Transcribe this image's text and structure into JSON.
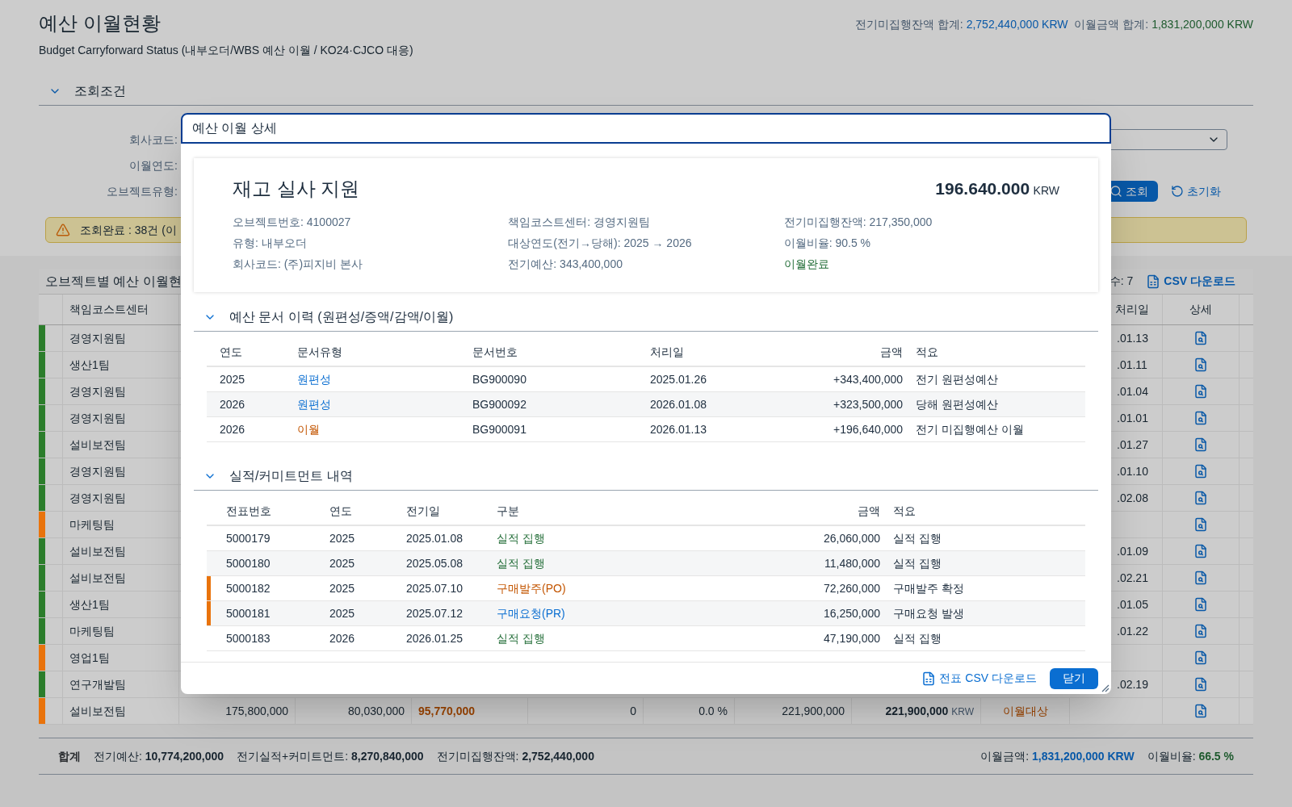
{
  "header": {
    "title": "예산 이월현황",
    "subtitle": "Budget Carryforward Status (내부오더/WBS 예산 이월 / KO24·CJCO 대응)",
    "totals": [
      {
        "label": "전기미집행잔액 합계:",
        "value": "2,752,440,000 KRW",
        "kind": "balance"
      },
      {
        "label": "이월금액 합계:",
        "value": "1,831,200,000 KRW",
        "kind": "carry"
      }
    ]
  },
  "filter": {
    "title": "조회조건",
    "expanded": true,
    "labels": [
      "회사코드:",
      "이월연도:",
      "오브젝트유형:"
    ],
    "search_button": "조회",
    "reset_button": "초기화",
    "message": {
      "kind": "warning",
      "text": "조회완료 : 38건 (이"
    }
  },
  "table": {
    "title": "오브젝트별 예산 이월현",
    "count": "수: 7",
    "csv_button": "CSV 다운로드",
    "columns": [
      {
        "label": "책임코스트센터",
        "kind": "cost_center"
      },
      {
        "label": "처리일",
        "kind": "date"
      },
      {
        "label": "상세",
        "kind": "detail"
      }
    ],
    "rows": [
      {
        "color": "#2b7d2b",
        "cost_center": "경영지원팀",
        "date": ".01.13"
      },
      {
        "color": "#2b7d2b",
        "cost_center": "생산1팀",
        "date": ".01.11"
      },
      {
        "color": "#2b7d2b",
        "cost_center": "경영지원팀",
        "date": ".01.04"
      },
      {
        "color": "#2b7d2b",
        "cost_center": "경영지원팀",
        "date": ".01.01"
      },
      {
        "color": "#2b7d2b",
        "cost_center": "설비보전팀",
        "date": ".01.27"
      },
      {
        "color": "#2b7d2b",
        "cost_center": "경영지원팀",
        "date": ".01.10"
      },
      {
        "color": "#2b7d2b",
        "cost_center": "경영지원팀",
        "date": ".02.08"
      },
      {
        "color": "#e9730c",
        "cost_center": "마케팅팀"
      },
      {
        "color": "#2b7d2b",
        "cost_center": "설비보전팀",
        "date": ".01.09"
      },
      {
        "color": "#2b7d2b",
        "cost_center": "설비보전팀",
        "date": ".02.21"
      },
      {
        "color": "#2b7d2b",
        "cost_center": "생산1팀",
        "date": ".01.05"
      },
      {
        "color": "#2b7d2b",
        "cost_center": "마케팅팀",
        "date": ".01.22"
      },
      {
        "color": "#e9730c",
        "cost_center": "영업1팀"
      },
      {
        "color": "#2b7d2b",
        "cost_center": "연구개발팀",
        "date": ".02.19"
      },
      {
        "color": "#e9730c",
        "cost_center": "설비보전팀",
        "cells": [
          {
            "kind": "number",
            "text": "175,800,000"
          },
          {
            "kind": "number",
            "text": "80,030,000"
          },
          {
            "kind": "warning_amount",
            "text": "95,770,000"
          },
          {
            "kind": "number",
            "text": "0"
          },
          {
            "kind": "number",
            "text": "0.0 %"
          },
          {
            "kind": "number",
            "text": "221,900,000"
          },
          {
            "kind": "amount",
            "text": "221,900,000",
            "unit": "KRW"
          },
          {
            "kind": "status_pending",
            "text": "이월대상"
          }
        ]
      }
    ]
  },
  "footer": {
    "label": "합계",
    "items": [
      {
        "label": "전기예산:",
        "value": "10,774,200,000"
      },
      {
        "label": "전기실적+커미트먼트:",
        "value": "8,270,840,000"
      },
      {
        "label": "전기미집행잔액:",
        "value": "2,752,440,000"
      }
    ],
    "right_items": [
      {
        "label": "이월금액:",
        "value": "1,831,200,000 KRW",
        "kind": "carry"
      },
      {
        "label": "이월비율:",
        "value": "66.5 %",
        "kind": "rate"
      }
    ]
  },
  "dialog": {
    "title": "예산 이월 상세",
    "summary": {
      "name": "재고 실사 지원",
      "amount": "196.640.000",
      "currency": "KRW",
      "columns": [
        [
          {
            "label": "오브젝트번호:",
            "value": "4100027"
          },
          {
            "label": "유형:",
            "value": "내부오더"
          },
          {
            "label": "회사코드:",
            "value": "(주)피지비 본사"
          }
        ],
        [
          {
            "label": "책임코스트센터:",
            "value": "경영지원팀"
          },
          {
            "label": "대상연도(전기→당해):",
            "value": "2025 → 2026"
          },
          {
            "label": "전기예산:",
            "value": "343,400,000"
          }
        ],
        [
          {
            "label": "전기미집행잔액:",
            "value": "217,350,000"
          },
          {
            "label": "이월비율:",
            "value": "90.5 %"
          },
          {
            "kind": "status_done",
            "text": "이월완료"
          }
        ]
      ]
    },
    "sections": [
      {
        "title": "예산 문서 이력 (원편성/증액/감액/이월)",
        "expanded": true,
        "kind": "documents",
        "columns": [
          "연도",
          "문서유형",
          "문서번호",
          "처리일",
          "금액",
          "적요"
        ],
        "rows": [
          {
            "flagged": false,
            "cells": [
              "2025",
              {
                "text": "원편성",
                "kind": "original"
              },
              "BG900090",
              "2025.01.26",
              "+343,400,000",
              "전기 원편성예산"
            ]
          },
          {
            "flagged": false,
            "cells": [
              "2026",
              {
                "text": "원편성",
                "kind": "original"
              },
              "BG900092",
              "2026.01.08",
              "+323,500,000",
              "당해 원편성예산"
            ]
          },
          {
            "flagged": false,
            "cells": [
              "2026",
              {
                "text": "이월",
                "kind": "carryover"
              },
              "BG900091",
              "2026.01.13",
              "+196,640,000",
              "전기 미집행예산 이월"
            ]
          }
        ]
      },
      {
        "title": "실적/커미트먼트 내역",
        "expanded": true,
        "kind": "postings",
        "columns": [
          "전표번호",
          "연도",
          "전기일",
          "구분",
          "금액",
          "적요"
        ],
        "rows": [
          {
            "flagged": false,
            "cells": [
              "5000179",
              "2025",
              "2025.01.08",
              {
                "text": "실적 집행",
                "kind": "actual"
              },
              "26,060,000",
              "실적 집행"
            ]
          },
          {
            "flagged": false,
            "cells": [
              "5000180",
              "2025",
              "2025.05.08",
              {
                "text": "실적 집행",
                "kind": "actual"
              },
              "11,480,000",
              "실적 집행"
            ]
          },
          {
            "flagged": true,
            "cells": [
              "5000182",
              "2025",
              "2025.07.10",
              {
                "text": "구매발주(PO)",
                "kind": "po"
              },
              "72,260,000",
              "구매발주 확정"
            ]
          },
          {
            "flagged": true,
            "cells": [
              "5000181",
              "2025",
              "2025.07.12",
              {
                "text": "구매요청(PR)",
                "kind": "pr"
              },
              "16,250,000",
              "구매요청 발생"
            ]
          },
          {
            "flagged": false,
            "cells": [
              "5000183",
              "2026",
              "2026.01.25",
              {
                "text": "실적 집행",
                "kind": "actual"
              },
              "47,190,000",
              "실적 집행"
            ]
          }
        ]
      }
    ],
    "csv_link": "전표 CSV 다운로드",
    "close_button": "닫기"
  }
}
